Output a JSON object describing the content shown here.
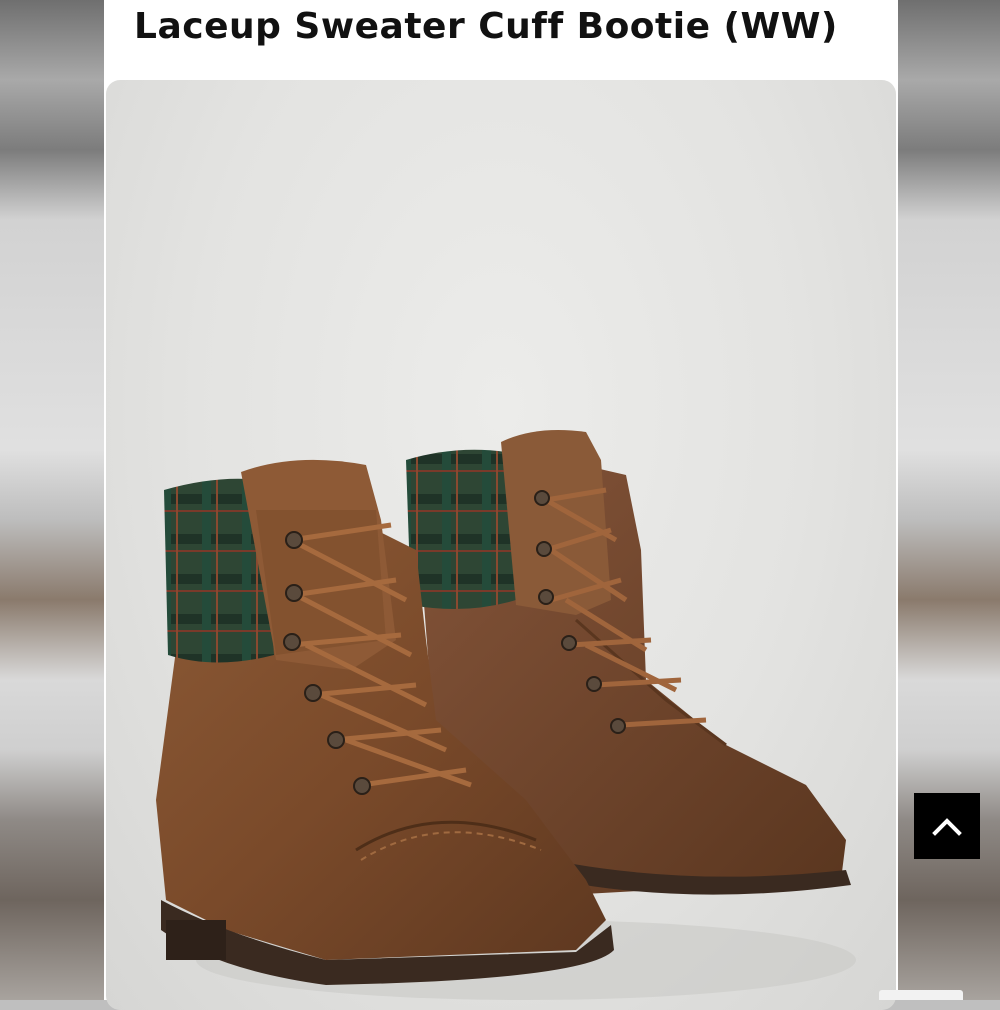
{
  "product": {
    "title": "Laceup Sweater Cuff Bootie (WW)"
  },
  "photo": {
    "subject": "pair of brown lace-up ankle boots with green plaid sweater cuffs"
  },
  "controls": {
    "scroll_top_icon": "chevron-up-icon"
  },
  "colors": {
    "leather": "#7a4a2a",
    "plaid": "#2f4a36",
    "sole": "#3a2a20",
    "button": "#000000"
  }
}
